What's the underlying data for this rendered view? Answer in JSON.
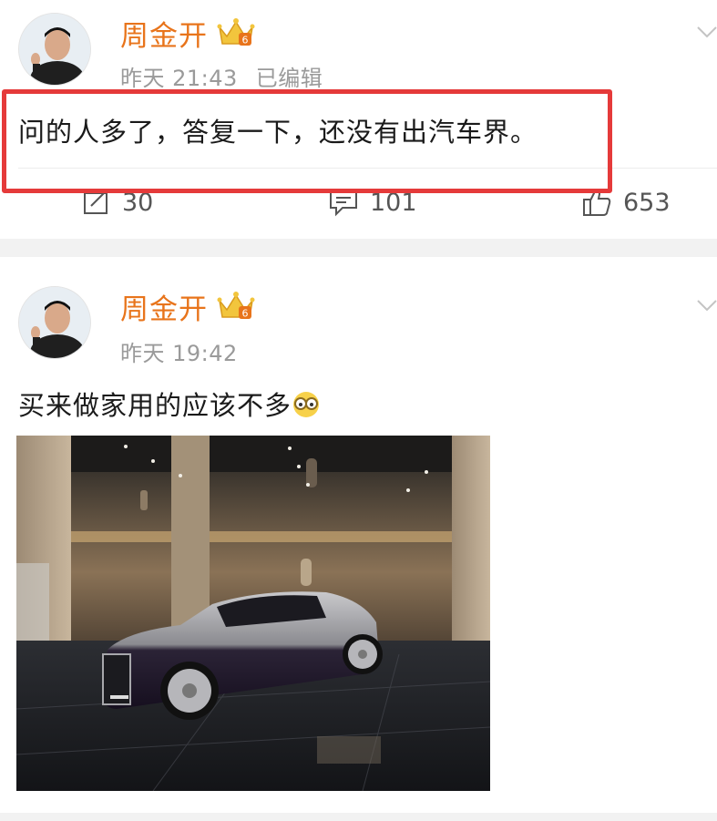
{
  "posts": [
    {
      "username": "周金开",
      "badge_level": "6",
      "time": "昨天 21:43",
      "edited": "已编辑",
      "text": "问的人多了，答复一下，还没有出汽车界。",
      "actions": {
        "repost_count": "30",
        "comment_count": "101",
        "like_count": "653"
      },
      "highlight_color": "#e53a3a"
    },
    {
      "username": "周金开",
      "badge_level": "6",
      "time": "昨天 19:42",
      "text": "买来做家用的应该不多",
      "emoji": "glasses-emoji",
      "image": "luxury-sedan-showroom-photo"
    }
  ],
  "colors": {
    "username": "#e8741b",
    "meta": "#9a9a9a",
    "highlight": "#e53a3a"
  }
}
